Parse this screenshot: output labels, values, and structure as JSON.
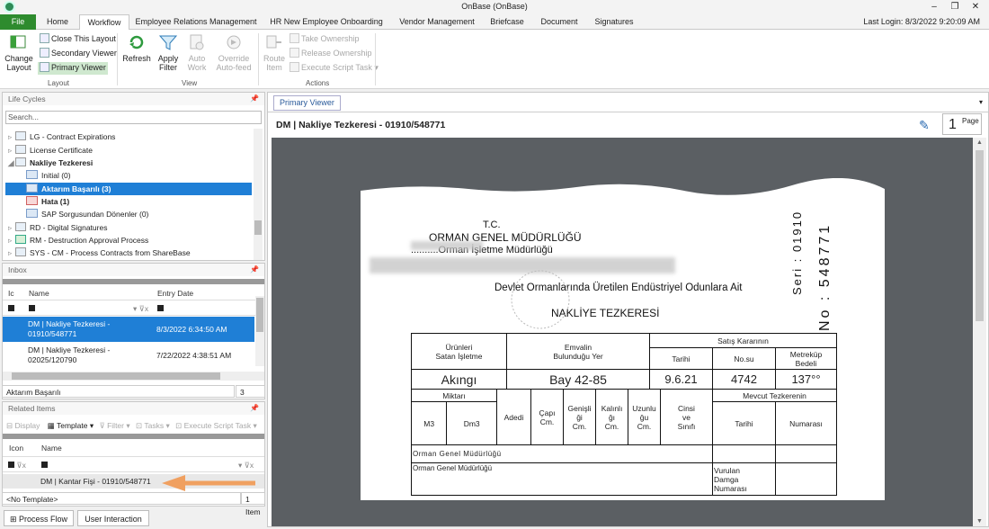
{
  "app": {
    "title": "OnBase (OnBase)",
    "last_login": "Last Login: 8/3/2022 9:20:09 AM"
  },
  "tabs": [
    "File",
    "Home",
    "Workflow",
    "Employee Relations Management",
    "HR New Employee Onboarding",
    "Vendor Management",
    "Briefcase",
    "Document",
    "Signatures"
  ],
  "ribbon": {
    "change_layout": "Change\nLayout",
    "close_layout": "Close This Layout",
    "secondary_viewer": "Secondary Viewer",
    "primary_viewer": "Primary Viewer",
    "refresh": "Refresh",
    "apply_filter": "Apply\nFilter",
    "auto_work": "Auto\nWork",
    "override_autofeed": "Override\nAuto-feed",
    "route_item": "Route\nItem",
    "take_ownership": "Take Ownership",
    "release_ownership": "Release Ownership",
    "execute_script": "Execute Script Task",
    "group_layout": "Layout",
    "group_view": "View",
    "group_actions": "Actions"
  },
  "lifecycles": {
    "title": "Life Cycles",
    "search_placeholder": "Search...",
    "items": [
      {
        "label": "LG - Contract Expirations"
      },
      {
        "label": "License Certificate"
      },
      {
        "label": "Nakliye Tezkeresi"
      },
      {
        "label": "Initial (0)"
      },
      {
        "label": "Aktarım Başarılı (3)"
      },
      {
        "label": "Hata (1)"
      },
      {
        "label": "SAP Sorgusundan Dönenler (0)"
      },
      {
        "label": "RD - Digital Signatures"
      },
      {
        "label": "RM - Destruction Approval Process"
      },
      {
        "label": "SYS - CM - Process Contracts from ShareBase"
      }
    ]
  },
  "inbox": {
    "title": "Inbox",
    "col_icon": "Ic",
    "col_name": "Name",
    "col_date": "Entry Date",
    "rows": [
      {
        "name": "DM | Nakliye Tezkeresi -\n01910/548771",
        "date": "8/3/2022 6:34:50 AM"
      },
      {
        "name": "DM | Nakliye Tezkeresi -\n02025/120790",
        "date": "7/22/2022 4:38:51 AM"
      }
    ],
    "status": "Aktarım Başarılı",
    "count": "3 Items"
  },
  "related": {
    "title": "Related Items",
    "display": "Display",
    "template": "Template",
    "filter": "Filter",
    "tasks": "Tasks",
    "execute": "Execute Script Task",
    "col_icon": "Icon",
    "col_name": "Name",
    "row": "DM | Kantar Fişi - 01910/548771",
    "status": "<No Template>",
    "count": "1 Item"
  },
  "bottom_tabs": [
    "Process Flow",
    "User Interaction"
  ],
  "viewer": {
    "tab": "Primary Viewer",
    "doc_title": "DM | Nakliye Tezkeresi - 01910/548771",
    "page_num": "1",
    "page_label": "Page"
  },
  "document": {
    "tc": "T.C.",
    "org": "ORMAN GENEL MÜDÜRLÜĞÜ",
    "dept": "..........Orman İşletme Müdürlüğü",
    "line": "Devlet Ormanlarında Üretilen Endüstriyel Odunlara Ait",
    "heading": "NAKLİYE TEZKERESİ",
    "serial": "Seri : 01910",
    "serial_no": "No : 548771",
    "col_urunleri": "Ürünleri\nSatan İşletme",
    "col_emvalin": "Emvalin\nBulunduğu Yer",
    "col_satis": "Satış Kararının",
    "col_tarihi": "Tarihi",
    "col_nosu": "No.su",
    "col_metrekup": "Metreküp\nBedeli",
    "hw1": "Akıngı",
    "hw2": "Bay 42-85",
    "hw3": "9.6.21",
    "hw4": "4742",
    "hw5": "137°°",
    "col_miktari": "Miktarı",
    "col_m3": "M3",
    "col_dm3": "Dm3",
    "col_adedi": "Adedi",
    "col_capi": "Çapı\nCm.",
    "col_genisligi": "Genişli\nği\nCm.",
    "col_kalinligi": "Kalınlı\nğı\nCm.",
    "col_uzunlugu": "Uzunlu\nğu\nCm.",
    "col_cinsi": "Cinsi\nve\nSınıfı",
    "col_mevcut": "Mevcut Tezkerenin",
    "col_tarihi2": "Tarihi",
    "col_numarasi": "Numarası",
    "stamp_row": "Orman  Genel  Müdürlüğü",
    "vurulan": "Vurulan\nDamga\nNumarası"
  },
  "colors": {
    "file_tab": "#2e8b2e",
    "selection": "#1f7fd6",
    "arrow": "#f0a060"
  }
}
